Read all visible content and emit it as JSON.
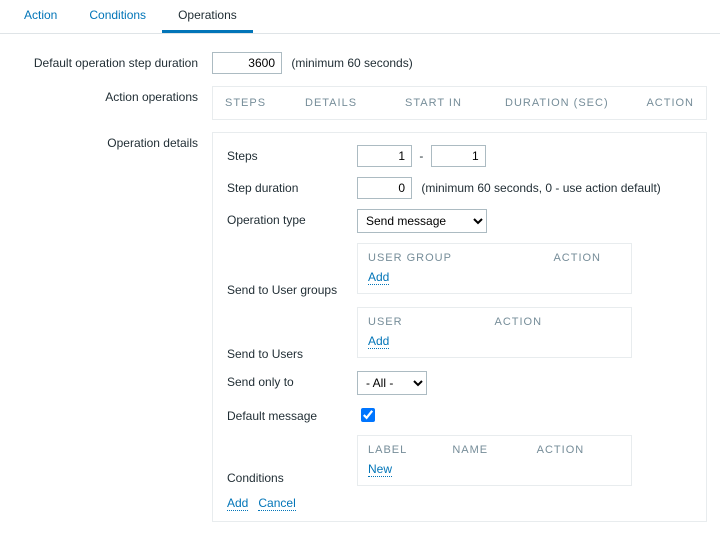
{
  "tabs": [
    "Action",
    "Conditions",
    "Operations"
  ],
  "active_tab": "Operations",
  "form": {
    "default_step_duration_label": "Default operation step duration",
    "default_step_duration_value": "3600",
    "default_step_duration_hint": "(minimum 60 seconds)",
    "action_operations_label": "Action operations",
    "operation_details_label": "Operation details"
  },
  "ops_columns": {
    "steps": "STEPS",
    "details": "DETAILS",
    "start_in": "START IN",
    "duration": "DURATION (SEC)",
    "action": "ACTION"
  },
  "details": {
    "steps_label": "Steps",
    "steps_from": "1",
    "steps_to": "1",
    "steps_sep": "-",
    "step_duration_label": "Step duration",
    "step_duration_value": "0",
    "step_duration_hint": "(minimum 60 seconds, 0 - use action default)",
    "operation_type_label": "Operation type",
    "operation_type_value": "Send message",
    "send_to_user_groups_label": "Send to User groups",
    "user_group_col": "USER GROUP",
    "action_col": "ACTION",
    "add_link": "Add",
    "send_to_users_label": "Send to Users",
    "user_col": "USER",
    "send_only_to_label": "Send only to",
    "send_only_to_value": "- All -",
    "default_message_label": "Default message",
    "default_message_checked": true,
    "conditions_label": "Conditions",
    "label_col": "LABEL",
    "name_col": "NAME",
    "new_link": "New",
    "cancel_link": "Cancel"
  }
}
